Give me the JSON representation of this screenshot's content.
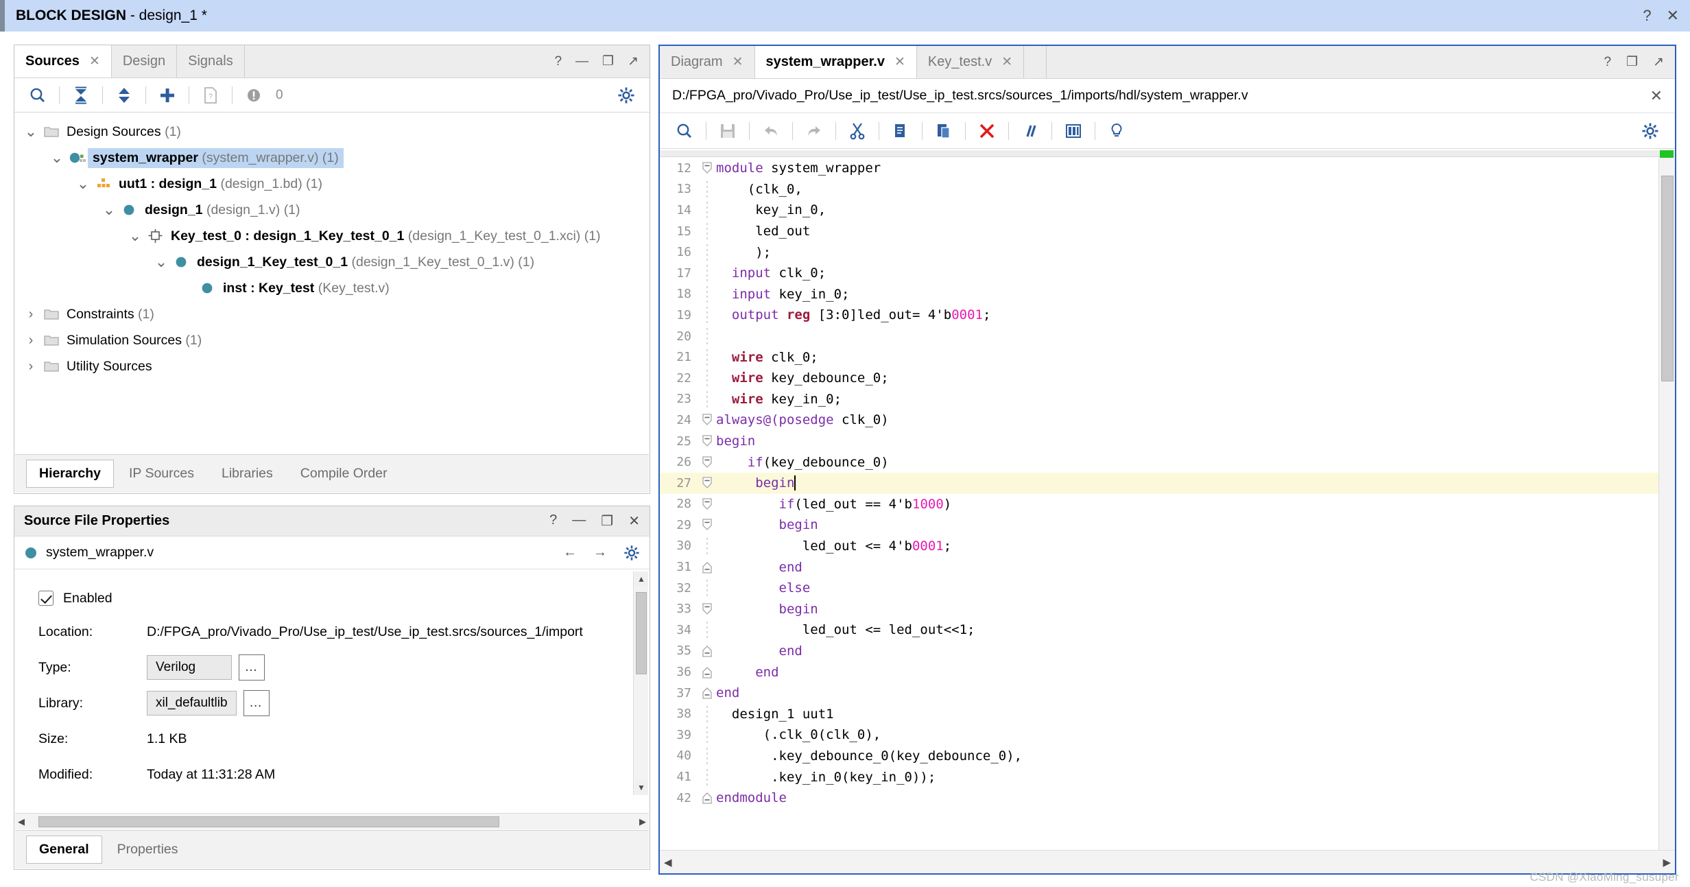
{
  "titlebar": {
    "prefix": "BLOCK DESIGN",
    "suffix": " - design_1 *",
    "help": "?",
    "close": "✕"
  },
  "sources_panel": {
    "tabs": [
      {
        "label": "Sources",
        "closable": true,
        "active": true
      },
      {
        "label": "Design",
        "closable": false,
        "active": false
      },
      {
        "label": "Signals",
        "closable": false,
        "active": false
      }
    ],
    "header_icons": [
      "?",
      "—",
      "❐",
      "↗"
    ],
    "toolbar": {
      "search": "search-icon",
      "collapse_all": "collapse-all-icon",
      "expand_all": "expand-all-icon",
      "add": "add-sources-icon",
      "report": "report-icon",
      "warning_count": "0",
      "settings": "gear-icon"
    },
    "tree": [
      {
        "indent": 0,
        "twisty": "⌄",
        "icon": "folder",
        "bold": "",
        "text": "Design Sources ",
        "muted": "(1)",
        "selected": false
      },
      {
        "indent": 1,
        "twisty": "⌄",
        "icon": "circle-block",
        "bold": "system_wrapper",
        "text": " ",
        "muted": "(system_wrapper.v) (1)",
        "selected": true
      },
      {
        "indent": 2,
        "twisty": "⌄",
        "icon": "bd-orange",
        "bold": "uut1 : design_1",
        "text": " ",
        "muted": "(design_1.bd) (1)",
        "selected": false
      },
      {
        "indent": 3,
        "twisty": "⌄",
        "icon": "circle",
        "bold": "design_1",
        "text": " ",
        "muted": "(design_1.v) (1)",
        "selected": false
      },
      {
        "indent": 4,
        "twisty": "⌄",
        "icon": "ip-core",
        "bold": "Key_test_0 : design_1_Key_test_0_1",
        "text": " ",
        "muted": "(design_1_Key_test_0_1.xci) (1)",
        "selected": false
      },
      {
        "indent": 5,
        "twisty": "⌄",
        "icon": "circle",
        "bold": "design_1_Key_test_0_1",
        "text": " ",
        "muted": "(design_1_Key_test_0_1.v) (1)",
        "selected": false
      },
      {
        "indent": 6,
        "twisty": "",
        "icon": "circle",
        "bold": "inst : Key_test",
        "text": " ",
        "muted": "(Key_test.v)",
        "selected": false
      },
      {
        "indent": 0,
        "twisty": "›",
        "icon": "folder",
        "bold": "",
        "text": "Constraints ",
        "muted": "(1)",
        "selected": false
      },
      {
        "indent": 0,
        "twisty": "›",
        "icon": "folder",
        "bold": "",
        "text": "Simulation Sources ",
        "muted": "(1)",
        "selected": false
      },
      {
        "indent": 0,
        "twisty": "›",
        "icon": "folder",
        "bold": "",
        "text": "Utility Sources",
        "muted": "",
        "selected": false
      }
    ],
    "bottom_tabs": [
      {
        "label": "Hierarchy",
        "active": true
      },
      {
        "label": "IP Sources",
        "active": false
      },
      {
        "label": "Libraries",
        "active": false
      },
      {
        "label": "Compile Order",
        "active": false
      }
    ]
  },
  "source_file_properties": {
    "title": "Source File Properties",
    "header_icons": [
      "?",
      "—",
      "❐",
      "✕"
    ],
    "file_name": "system_wrapper.v",
    "nav_icons": [
      "←",
      "→",
      "gear-icon"
    ],
    "enabled_label": "Enabled",
    "enabled_checked": true,
    "rows": [
      {
        "label": "Location:",
        "value": "D:/FPGA_pro/Vivado_Pro/Use_ip_test/Use_ip_test.srcs/sources_1/import",
        "kind": "text"
      },
      {
        "label": "Type:",
        "value": "Verilog",
        "kind": "combo",
        "dots": "…"
      },
      {
        "label": "Library:",
        "value": "xil_defaultlib",
        "kind": "combo",
        "dots": "…"
      },
      {
        "label": "Size:",
        "value": "1.1 KB",
        "kind": "text"
      },
      {
        "label": "Modified:",
        "value": "Today at 11:31:28 AM",
        "kind": "text"
      }
    ],
    "bottom_tabs": [
      {
        "label": "General",
        "active": true
      },
      {
        "label": "Properties",
        "active": false
      }
    ]
  },
  "editor": {
    "tabs": [
      {
        "label": "Diagram",
        "active": false,
        "closable": true
      },
      {
        "label": "system_wrapper.v",
        "active": true,
        "closable": true
      },
      {
        "label": "Key_test.v",
        "active": false,
        "closable": true
      }
    ],
    "header_icons": [
      "?",
      "❐",
      "↗"
    ],
    "file_path": "D:/FPGA_pro/Vivado_Pro/Use_ip_test/Use_ip_test.srcs/sources_1/imports/hdl/system_wrapper.v",
    "path_close": "✕",
    "toolbar_icons": [
      "search-icon",
      "save-icon",
      "undo-icon",
      "redo-icon",
      "cut-icon",
      "copy-icon",
      "paste-icon",
      "delete-icon",
      "comment-icon",
      "columns-icon",
      "bulb-icon",
      "gear-icon"
    ],
    "cursor_line": 27,
    "code": [
      {
        "n": 12,
        "fold": "minus",
        "tokens": [
          {
            "t": "module ",
            "c": "kw"
          },
          {
            "t": "system_wrapper",
            "c": ""
          }
        ],
        "indent": 0
      },
      {
        "n": 13,
        "fold": "",
        "tokens": [
          {
            "t": "    (clk_0,",
            "c": ""
          }
        ],
        "indent": 0
      },
      {
        "n": 14,
        "fold": "",
        "tokens": [
          {
            "t": "     key_in_0,",
            "c": ""
          }
        ],
        "indent": 0
      },
      {
        "n": 15,
        "fold": "",
        "tokens": [
          {
            "t": "     led_out",
            "c": ""
          }
        ],
        "indent": 0
      },
      {
        "n": 16,
        "fold": "",
        "tokens": [
          {
            "t": "     );",
            "c": ""
          }
        ],
        "indent": 0
      },
      {
        "n": 17,
        "fold": "",
        "tokens": [
          {
            "t": "  input",
            "c": "kw"
          },
          {
            "t": " clk_0;",
            "c": ""
          }
        ],
        "indent": 0
      },
      {
        "n": 18,
        "fold": "",
        "tokens": [
          {
            "t": "  input",
            "c": "kw"
          },
          {
            "t": " key_in_0;",
            "c": ""
          }
        ],
        "indent": 0
      },
      {
        "n": 19,
        "fold": "",
        "tokens": [
          {
            "t": "  output ",
            "c": "kw"
          },
          {
            "t": "reg",
            "c": "kwb"
          },
          {
            "t": " [3:0]led_out= 4'b",
            "c": ""
          },
          {
            "t": "0001",
            "c": "num"
          },
          {
            "t": ";",
            "c": ""
          }
        ],
        "indent": 0
      },
      {
        "n": 20,
        "fold": "",
        "tokens": [
          {
            "t": "",
            "c": ""
          }
        ],
        "indent": 0
      },
      {
        "n": 21,
        "fold": "",
        "tokens": [
          {
            "t": "  ",
            "c": ""
          },
          {
            "t": "wire",
            "c": "kwb"
          },
          {
            "t": " clk_0;",
            "c": ""
          }
        ],
        "indent": 0
      },
      {
        "n": 22,
        "fold": "",
        "tokens": [
          {
            "t": "  ",
            "c": ""
          },
          {
            "t": "wire",
            "c": "kwb"
          },
          {
            "t": " key_debounce_0;",
            "c": ""
          }
        ],
        "indent": 0
      },
      {
        "n": 23,
        "fold": "",
        "tokens": [
          {
            "t": "  ",
            "c": ""
          },
          {
            "t": "wire",
            "c": "kwb"
          },
          {
            "t": " key_in_0;",
            "c": ""
          }
        ],
        "indent": 0
      },
      {
        "n": 24,
        "fold": "minus",
        "tokens": [
          {
            "t": "always@(",
            "c": "kw"
          },
          {
            "t": "posedge",
            "c": "kw"
          },
          {
            "t": " clk_0)",
            "c": ""
          }
        ],
        "indent": 0
      },
      {
        "n": 25,
        "fold": "minus",
        "tokens": [
          {
            "t": "begin",
            "c": "kw"
          }
        ],
        "indent": 0
      },
      {
        "n": 26,
        "fold": "minus",
        "tokens": [
          {
            "t": "    ",
            "c": ""
          },
          {
            "t": "if",
            "c": "kw"
          },
          {
            "t": "(key_debounce_0)",
            "c": ""
          }
        ],
        "indent": 0
      },
      {
        "n": 27,
        "fold": "minus",
        "tokens": [
          {
            "t": "     ",
            "c": ""
          },
          {
            "t": "begin",
            "c": "kw"
          }
        ],
        "indent": 0
      },
      {
        "n": 28,
        "fold": "minus",
        "tokens": [
          {
            "t": "        ",
            "c": ""
          },
          {
            "t": "if",
            "c": "kw"
          },
          {
            "t": "(led_out == 4'b",
            "c": ""
          },
          {
            "t": "1000",
            "c": "num"
          },
          {
            "t": ")",
            "c": ""
          }
        ],
        "indent": 0
      },
      {
        "n": 29,
        "fold": "minus",
        "tokens": [
          {
            "t": "        ",
            "c": ""
          },
          {
            "t": "begin",
            "c": "kw"
          }
        ],
        "indent": 0
      },
      {
        "n": 30,
        "fold": "",
        "tokens": [
          {
            "t": "           led_out <= 4'b",
            "c": ""
          },
          {
            "t": "0001",
            "c": "num"
          },
          {
            "t": ";",
            "c": ""
          }
        ],
        "indent": 0
      },
      {
        "n": 31,
        "fold": "plusend",
        "tokens": [
          {
            "t": "        ",
            "c": ""
          },
          {
            "t": "end",
            "c": "kw"
          }
        ],
        "indent": 0
      },
      {
        "n": 32,
        "fold": "",
        "tokens": [
          {
            "t": "        ",
            "c": ""
          },
          {
            "t": "else",
            "c": "kw"
          }
        ],
        "indent": 0
      },
      {
        "n": 33,
        "fold": "minus",
        "tokens": [
          {
            "t": "        ",
            "c": ""
          },
          {
            "t": "begin",
            "c": "kw"
          }
        ],
        "indent": 0
      },
      {
        "n": 34,
        "fold": "",
        "tokens": [
          {
            "t": "           led_out <= led_out<<1;",
            "c": ""
          }
        ],
        "indent": 0
      },
      {
        "n": 35,
        "fold": "plusend",
        "tokens": [
          {
            "t": "        ",
            "c": ""
          },
          {
            "t": "end",
            "c": "kw"
          }
        ],
        "indent": 0
      },
      {
        "n": 36,
        "fold": "plusend",
        "tokens": [
          {
            "t": "     ",
            "c": ""
          },
          {
            "t": "end",
            "c": "kw"
          }
        ],
        "indent": 0
      },
      {
        "n": 37,
        "fold": "plusend",
        "tokens": [
          {
            "t": "end",
            "c": "kw"
          }
        ],
        "indent": 0
      },
      {
        "n": 38,
        "fold": "",
        "tokens": [
          {
            "t": "  design_1 uut1",
            "c": ""
          }
        ],
        "indent": 0
      },
      {
        "n": 39,
        "fold": "",
        "tokens": [
          {
            "t": "      (.clk_0(clk_0),",
            "c": ""
          }
        ],
        "indent": 0
      },
      {
        "n": 40,
        "fold": "",
        "tokens": [
          {
            "t": "       .key_debounce_0(key_debounce_0),",
            "c": ""
          }
        ],
        "indent": 0
      },
      {
        "n": 41,
        "fold": "",
        "tokens": [
          {
            "t": "       .key_in_0(key_in_0));",
            "c": ""
          }
        ],
        "indent": 0
      },
      {
        "n": 42,
        "fold": "plusend",
        "tokens": [
          {
            "t": "endmodule",
            "c": "kw"
          }
        ],
        "indent": 0
      }
    ]
  },
  "watermark": "CSDN @XiaoMing_susuper",
  "colors": {
    "title_bg": "#c6d9f7",
    "selection": "#bcd5f2",
    "highlight_line": "#fbf9da",
    "keyword": "#7b2ca8",
    "keyword_bold": "#9c1b3c",
    "number": "#e61cb0",
    "icon_blue": "#2e5d9e",
    "node_teal": "#3f8fa3",
    "editor_border": "#2b5fbf"
  }
}
